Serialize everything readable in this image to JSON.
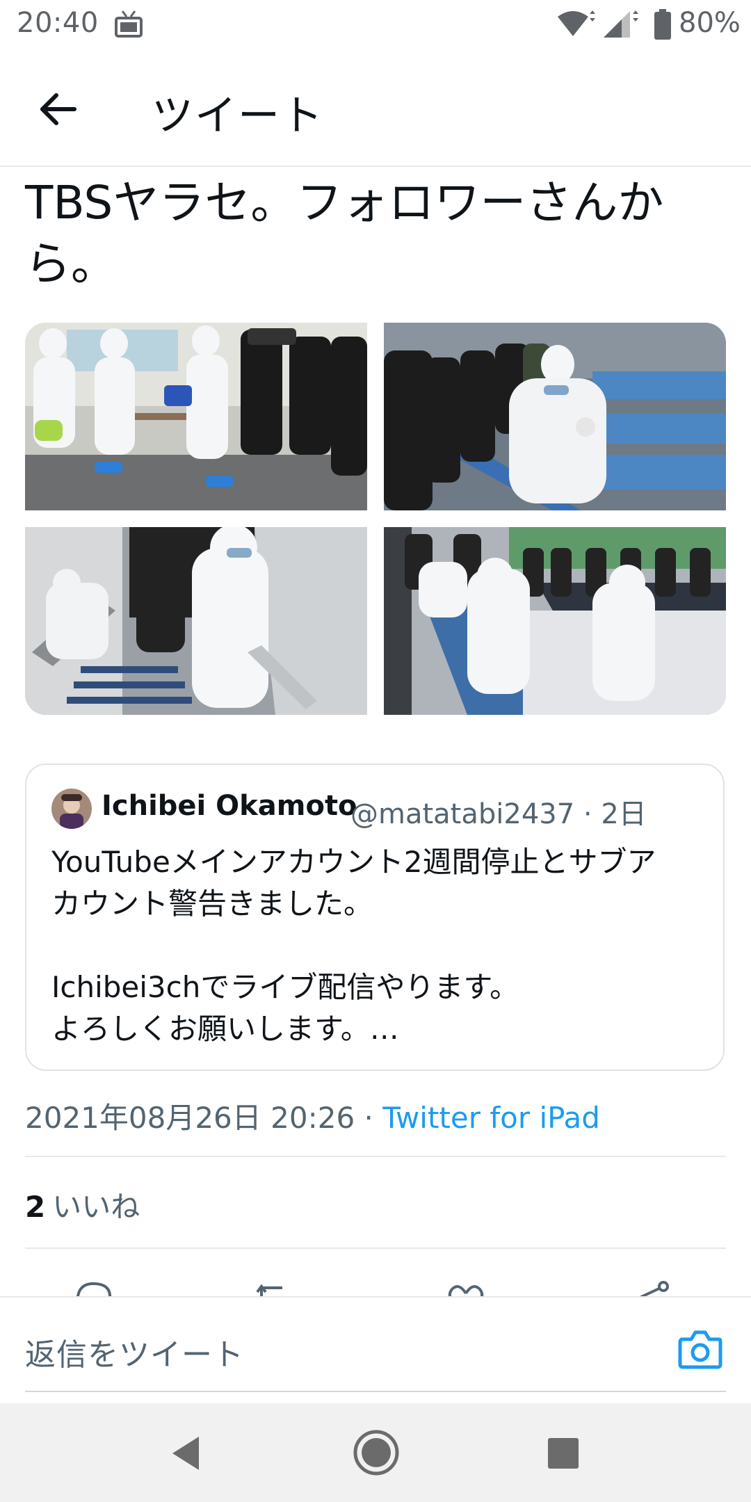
{
  "status_bar": {
    "time": "20:40",
    "battery": "80%",
    "icons": [
      "tv-icon",
      "wifi-icon",
      "signal-icon",
      "battery-icon"
    ]
  },
  "header": {
    "title": "ツイート",
    "back_icon": "arrow-left-icon"
  },
  "tweet": {
    "text_line1": "TBSヤラセ。フォロワーさんか",
    "text_line2": "ら。",
    "timestamp": "2021年08月26日 20:26",
    "separator": " · ",
    "source": "Twitter for iPad",
    "likes_count": "2",
    "likes_label": "いいね"
  },
  "quote": {
    "name": "Ichibei Okamoto",
    "handle": "@matatabi2437 · 2日",
    "lines": [
      "YouTubeメインアカウント2週間停止とサブア",
      "カウント警告きました。",
      "",
      "Ichibei3chでライブ配信やります。",
      "よろしくお願いします。…"
    ]
  },
  "actions": [
    "reply-icon",
    "retweet-icon",
    "like-icon",
    "share-icon"
  ],
  "reply_bar": {
    "placeholder": "返信をツイート",
    "camera_icon": "camera-icon"
  },
  "colors": {
    "accent": "#1d9bf0",
    "secondary_text": "#536471",
    "primary_text": "#0f1419"
  }
}
